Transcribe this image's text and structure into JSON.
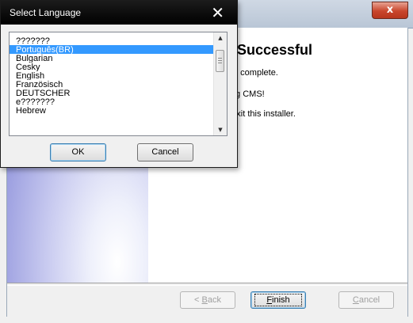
{
  "installer": {
    "close_glyph": "x",
    "heading": "n Successful",
    "line1": "n is complete.",
    "line2": "sing CMS!",
    "line3": "o exit this installer.",
    "buttons": {
      "back": {
        "prefix": "< ",
        "mnemonic": "B",
        "rest": "ack"
      },
      "finish": {
        "mnemonic": "F",
        "rest": "inish"
      },
      "cancel": {
        "mnemonic": "C",
        "rest": "ancel"
      }
    }
  },
  "dialog": {
    "title": "Select Language",
    "close_glyph": "✕",
    "languages": [
      "???????",
      "Português(BR)",
      "Bulgarian",
      "Cesky",
      "English",
      "Französisch",
      "DEUTSCHER",
      "e???????",
      "Hebrew"
    ],
    "selected_language": "Português(BR)",
    "ok_label": "OK",
    "cancel_label": "Cancel",
    "scroll_up_glyph": "▲",
    "scroll_down_glyph": "▼"
  }
}
